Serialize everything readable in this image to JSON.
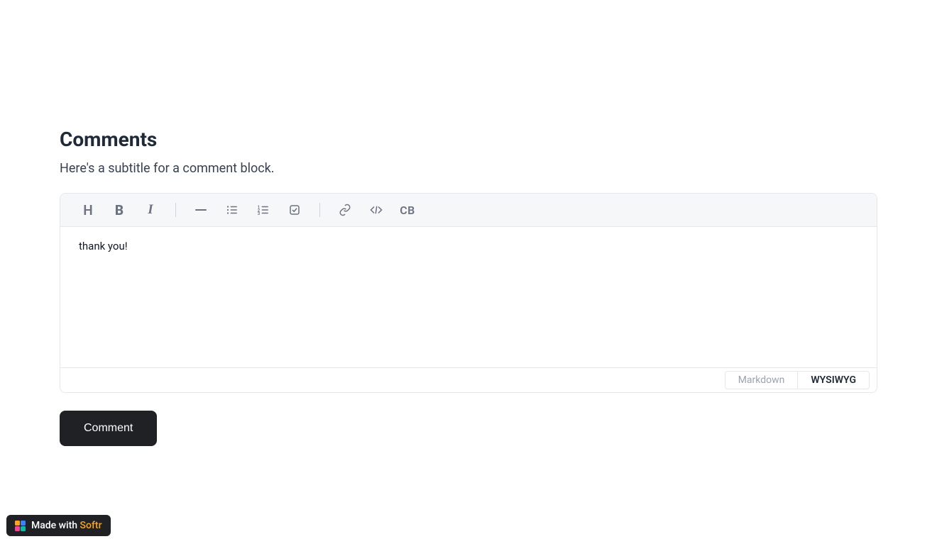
{
  "header": {
    "title": "Comments",
    "subtitle": "Here's a subtitle for a comment block."
  },
  "editor": {
    "content": "thank you!",
    "toolbar": {
      "heading": "H",
      "bold": "B",
      "italic": "I",
      "codeblock": "CB"
    },
    "modes": {
      "markdown": "Markdown",
      "wysiwyg": "WYSIWYG",
      "active": "wysiwyg"
    }
  },
  "actions": {
    "submit": "Comment"
  },
  "badge": {
    "prefix": "Made with ",
    "brand": "Softr",
    "colors": {
      "orange": "#f5a623",
      "blue": "#3b82f6",
      "pink": "#ec4899",
      "teal": "#14b8a6"
    }
  }
}
